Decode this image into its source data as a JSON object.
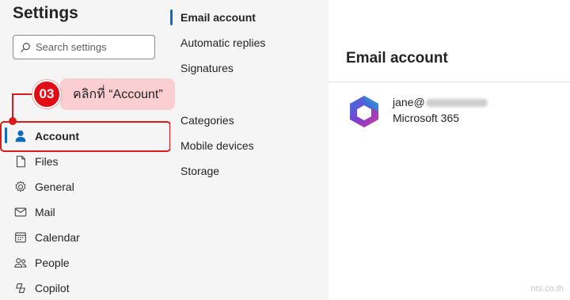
{
  "settings": {
    "title": "Settings",
    "search_placeholder": "Search settings"
  },
  "annotation": {
    "step": "03",
    "text": "คลิกที่ “Account”",
    "color": "#e00d16"
  },
  "sidebar": {
    "items": [
      {
        "label": "Account",
        "icon": "person-icon",
        "selected": true
      },
      {
        "label": "Files",
        "icon": "file-icon"
      },
      {
        "label": "General",
        "icon": "gear-icon"
      },
      {
        "label": "Mail",
        "icon": "mail-icon"
      },
      {
        "label": "Calendar",
        "icon": "calendar-icon"
      },
      {
        "label": "People",
        "icon": "people-icon"
      },
      {
        "label": "Copilot",
        "icon": "copilot-icon"
      }
    ]
  },
  "submenu": {
    "items": [
      {
        "label": "Email account",
        "selected": true
      },
      {
        "label": "Automatic replies"
      },
      {
        "label": "Signatures"
      },
      {
        "label": "Categories"
      },
      {
        "label": "Mobile devices"
      },
      {
        "label": "Storage"
      }
    ]
  },
  "panel": {
    "title": "Email account",
    "account": {
      "email_prefix": "jane@",
      "type": "Microsoft 365",
      "logo": "microsoft-365-logo"
    }
  },
  "watermark": "nts.co.th",
  "colors": {
    "accent": "#0f6cbd",
    "highlight": "#d81b1b",
    "callout_bg": "#fbcfd2"
  }
}
